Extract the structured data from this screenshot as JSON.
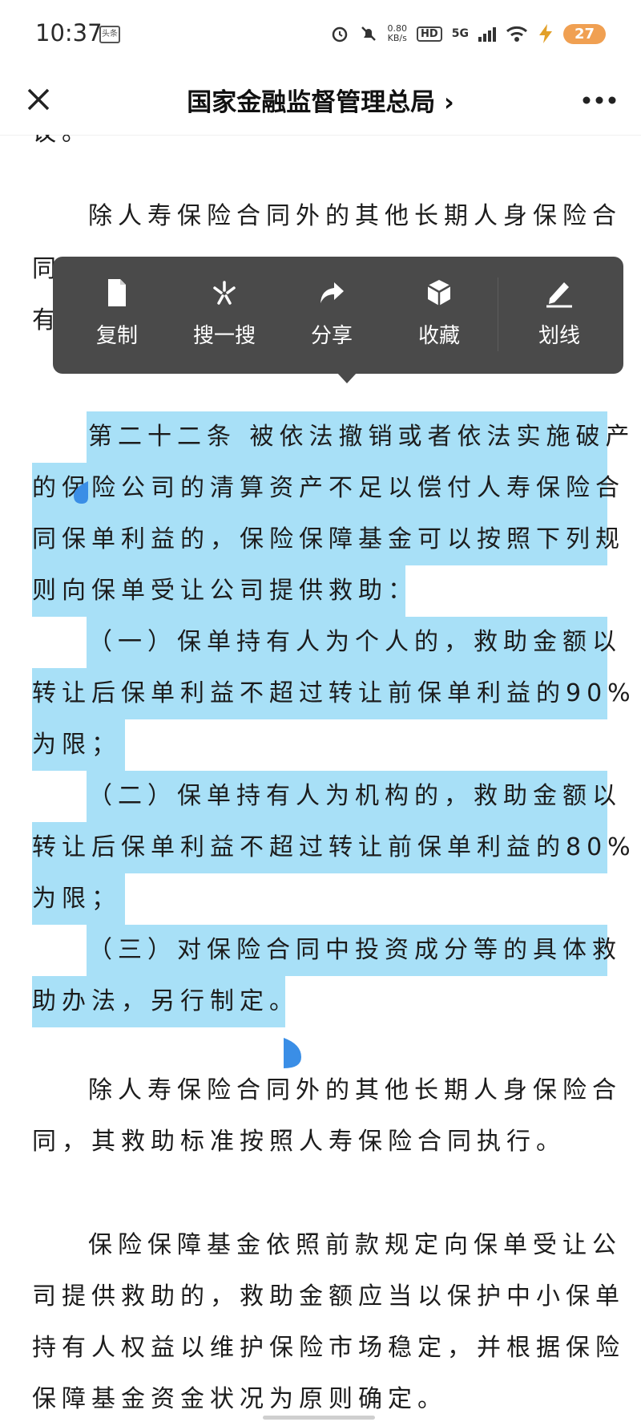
{
  "status_bar": {
    "time": "10:37",
    "news_badge": "头条",
    "net_speed_value": "0.80",
    "net_speed_unit": "KB/s",
    "hd_label": "HD",
    "signal_label": "5G",
    "battery": "27",
    "battery_color": "#f0a052"
  },
  "nav": {
    "title": "国家金融监督管理总局 ›"
  },
  "popup_menu": {
    "items": [
      {
        "label": "复制",
        "icon": "document-icon"
      },
      {
        "label": "搜一搜",
        "icon": "sparkle-search-icon"
      },
      {
        "label": "分享",
        "icon": "share-arrow-icon"
      },
      {
        "label": "收藏",
        "icon": "cube-icon"
      },
      {
        "label": "划线",
        "icon": "pen-underline-icon"
      }
    ]
  },
  "article": {
    "lines": [
      "议。",
      "除人寿保险合同外的其他长期人身保险合",
      "同",
      "有",
      "第二十二条 被依法撤销或者依法实施破产",
      "的保险公司的清算资产不足以偿付人寿保险合",
      "同保单利益的，保险保障基金可以按照下列规",
      "则向保单受让公司提供救助：",
      "（一）保单持有人为个人的，救助金额以",
      "转让后保单利益不超过转让前保单利益的90%",
      "为限；",
      "（二）保单持有人为机构的，救助金额以",
      "转让后保单利益不超过转让前保单利益的80%",
      "为限；",
      "（三）对保险合同中投资成分等的具体救",
      "助办法，另行制定。",
      "除人寿保险合同外的其他长期人身保险合",
      "同，其救助标准按照人寿保险合同执行。",
      "保险保障基金依照前款规定向保单受让公",
      "司提供救助的，救助金额应当以保护中小保单",
      "持有人权益以维护保险市场稳定，并根据保险",
      "保障基金资金状况为原则确定。"
    ]
  },
  "selection_color": "#a8e0f7",
  "handle_color": "#3a8ee6"
}
